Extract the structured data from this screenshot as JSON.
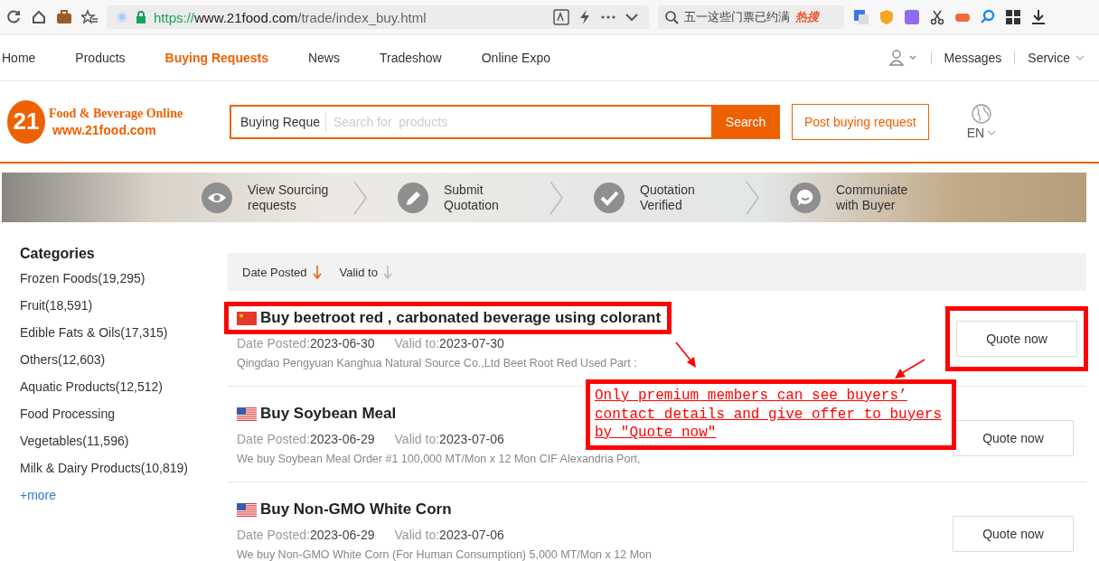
{
  "browser": {
    "url_scheme": "https://",
    "url_host": "www.21food.com",
    "url_path": "/trade/index_buy.html",
    "search_suggestion": "五一这些门票已约满",
    "hot_badge": "热搜"
  },
  "nav": {
    "items": [
      {
        "label": "Home",
        "selected": false
      },
      {
        "label": "Products",
        "selected": false
      },
      {
        "label": "Buying Requests",
        "selected": true
      },
      {
        "label": "News",
        "selected": false
      },
      {
        "label": "Tradeshow",
        "selected": false
      },
      {
        "label": "Online Expo",
        "selected": false
      }
    ],
    "messages": "Messages",
    "service": "Service"
  },
  "header": {
    "logo_number": "21",
    "logo_title": "Food & Beverage Online",
    "logo_url": "www.21food.com",
    "search_scope": "Buying Reque",
    "search_placeholder": "Search for  products",
    "search_button": "Search",
    "post_button": "Post buying request",
    "language": "EN"
  },
  "steps": [
    {
      "kind": "view",
      "label": "View Sourcing requests"
    },
    {
      "kind": "edit",
      "label": "Submit Quotation"
    },
    {
      "kind": "check",
      "label": "Quotation Verified"
    },
    {
      "kind": "chat",
      "label": "Communiate with Buyer"
    }
  ],
  "categories": {
    "title": "Categories",
    "items": [
      "Frozen Foods(19,295)",
      "Fruit(18,591)",
      "Edible Fats & Oils(17,315)",
      "Others(12,603)",
      "Aquatic Products(12,512)",
      "Food Processing",
      "Vegetables(11,596)",
      "Milk & Dairy Products(10,819)"
    ],
    "more": "+more"
  },
  "sort": [
    {
      "label": "Date Posted",
      "selected": true
    },
    {
      "label": "Valid to",
      "selected": false
    }
  ],
  "requests": [
    {
      "kind": "cn",
      "title": "Buy beetroot red , carbonated beverage using colorant",
      "date_label": "Date Posted:",
      "date": "2023-06-30",
      "valid_label": "Valid to:",
      "valid": "2023-07-30",
      "description": "Qingdao Pengyuan Kanghua Natural Source Co.,Ltd Beet Root Red Used Part :",
      "button": "Quote now",
      "highlighted": true
    },
    {
      "kind": "us",
      "title": "Buy Soybean Meal",
      "date_label": "Date Posted:",
      "date": "2023-06-29",
      "valid_label": "Valid to:",
      "valid": "2023-07-06",
      "description": "We buy Soybean Meal Order #1 100,000 MT/Mon x 12 Mon CIF Alexandria Port,",
      "button": "Quote now",
      "highlighted": false
    },
    {
      "kind": "us",
      "title": "Buy Non-GMO White Corn",
      "date_label": "Date Posted:",
      "date": "2023-06-29",
      "valid_label": "Valid to:",
      "valid": "2023-07-06",
      "description": "We buy Non-GMO White Corn (For Human Consumption) 5,000 MT/Mon x 12 Mon",
      "button": "Quote now",
      "highlighted": false
    }
  ],
  "annotation": {
    "note": "Only premium members can see buyers’ contact details and give offer to buyers by ″Quote now″"
  }
}
